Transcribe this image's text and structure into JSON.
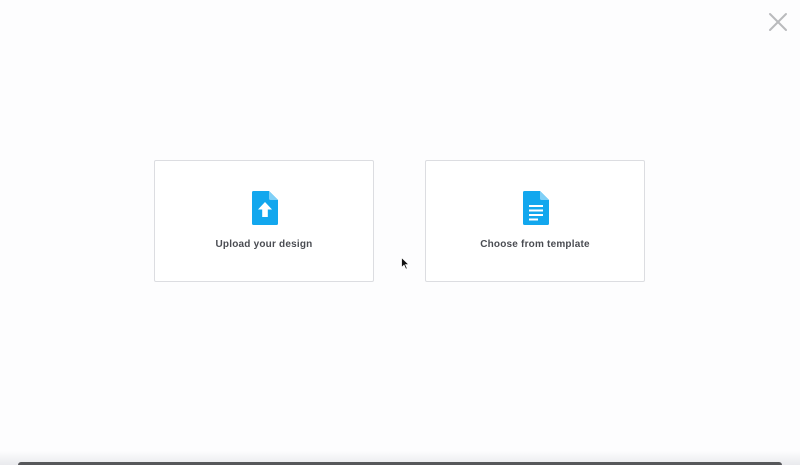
{
  "dialog": {
    "close_icon": "close-icon",
    "options": [
      {
        "id": "upload",
        "label": "Upload your design",
        "icon": "upload-file-icon"
      },
      {
        "id": "template",
        "label": "Choose from template",
        "icon": "document-icon"
      }
    ]
  },
  "colors": {
    "accent": "#12a7ee",
    "card_border": "#dcdde1",
    "label_text": "#4a4c52",
    "close_icon": "#b9babd"
  }
}
